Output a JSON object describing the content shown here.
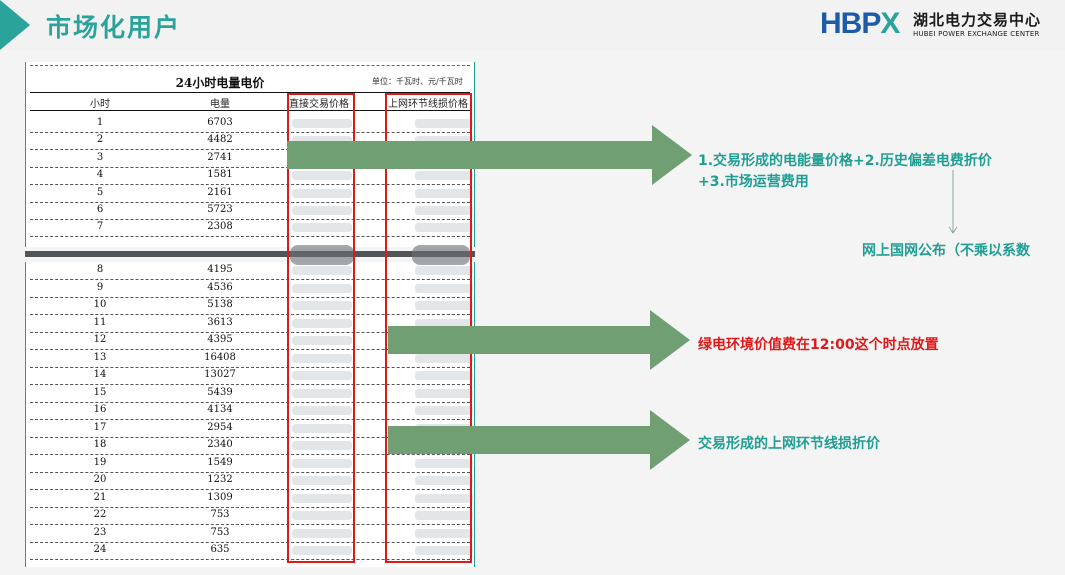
{
  "slide": {
    "title": "市场化用户",
    "logo_text": "HBPX",
    "logo_cn": "湖北电力交易中心",
    "logo_en": "HUBEI POWER EXCHANGE CENTER"
  },
  "table": {
    "title": "24小时电量电价",
    "unit": "单位：千瓦时、元/千瓦时",
    "headers": [
      "小时",
      "电量",
      "直接交易价格",
      "上网环节线损价格"
    ],
    "rows": [
      {
        "hour": "1",
        "volume": "6703"
      },
      {
        "hour": "2",
        "volume": "4482"
      },
      {
        "hour": "3",
        "volume": "2741"
      },
      {
        "hour": "4",
        "volume": "1581"
      },
      {
        "hour": "5",
        "volume": "2161"
      },
      {
        "hour": "6",
        "volume": "5723"
      },
      {
        "hour": "7",
        "volume": "2308"
      },
      {
        "hour": "8",
        "volume": "4195"
      },
      {
        "hour": "9",
        "volume": "4536"
      },
      {
        "hour": "10",
        "volume": "5138"
      },
      {
        "hour": "11",
        "volume": "3613"
      },
      {
        "hour": "12",
        "volume": "4395"
      },
      {
        "hour": "13",
        "volume": "16408"
      },
      {
        "hour": "14",
        "volume": "13027"
      },
      {
        "hour": "15",
        "volume": "5439"
      },
      {
        "hour": "16",
        "volume": "4134"
      },
      {
        "hour": "17",
        "volume": "2954"
      },
      {
        "hour": "18",
        "volume": "2340"
      },
      {
        "hour": "19",
        "volume": "1549"
      },
      {
        "hour": "20",
        "volume": "1232"
      },
      {
        "hour": "21",
        "volume": "1309"
      },
      {
        "hour": "22",
        "volume": "753"
      },
      {
        "hour": "23",
        "volume": "753"
      },
      {
        "hour": "24",
        "volume": "635"
      }
    ]
  },
  "annotations": {
    "note1_line1": "1.交易形成的电能量价格+2.历史偏差电费折价",
    "note1_line2": "+3.市场运营费用",
    "note1_sub": "网上国网公布（不乘以系数",
    "note2": "绿电环境价值费在12:00这个时点放置",
    "note3": "交易形成的上网环节线损折价"
  },
  "colors": {
    "accent_teal": "#2aa39a",
    "arrow_green": "#6f9f72",
    "highlight_red": "#e01818",
    "logo_blue": "#1d5aa8"
  }
}
